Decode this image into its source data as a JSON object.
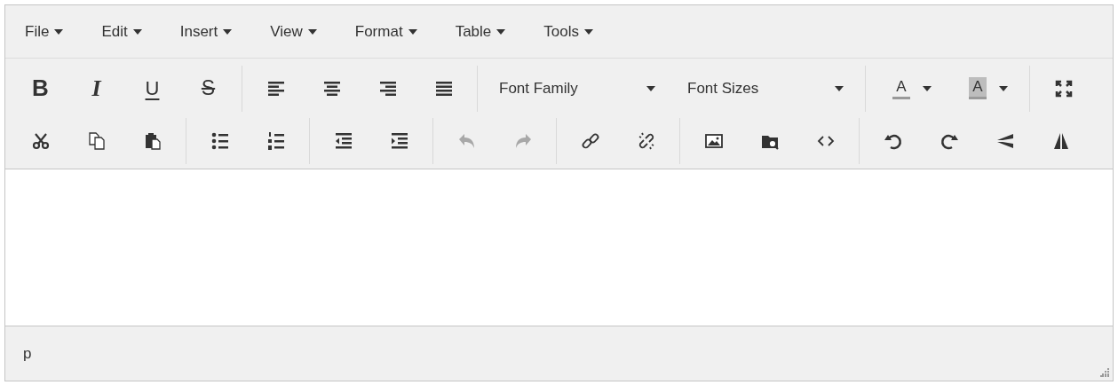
{
  "menubar": [
    {
      "label": "File"
    },
    {
      "label": "Edit"
    },
    {
      "label": "Insert"
    },
    {
      "label": "View"
    },
    {
      "label": "Format"
    },
    {
      "label": "Table"
    },
    {
      "label": "Tools"
    }
  ],
  "toolbar_rows": [
    [
      {
        "buttons": [
          {
            "kind": "bold",
            "label": "B",
            "disabled": false
          },
          {
            "kind": "italic",
            "label": "I",
            "disabled": false
          },
          {
            "kind": "underline",
            "label": "U",
            "disabled": false
          },
          {
            "kind": "strikethrough",
            "label": "S",
            "disabled": false
          }
        ]
      },
      {
        "buttons": [
          {
            "kind": "align-left",
            "disabled": false
          },
          {
            "kind": "align-center",
            "disabled": false
          },
          {
            "kind": "align-right",
            "disabled": false
          },
          {
            "kind": "align-justify",
            "disabled": false
          }
        ]
      },
      {
        "buttons": [
          {
            "kind": "listbox",
            "label": "Font Family",
            "disabled": false
          },
          {
            "kind": "listbox",
            "label": "Font Sizes",
            "disabled": false
          }
        ]
      },
      {
        "buttons": [
          {
            "kind": "forecolor",
            "label": "A",
            "disabled": false
          },
          {
            "kind": "backcolor",
            "label": "A",
            "disabled": false
          }
        ]
      },
      {
        "buttons": [
          {
            "kind": "fullscreen",
            "disabled": false
          }
        ]
      }
    ],
    [
      {
        "buttons": [
          {
            "kind": "cut",
            "disabled": false
          },
          {
            "kind": "copy",
            "disabled": false
          },
          {
            "kind": "paste",
            "disabled": false
          }
        ]
      },
      {
        "buttons": [
          {
            "kind": "bullet-list",
            "disabled": false
          },
          {
            "kind": "numbered-list",
            "disabled": false
          }
        ]
      },
      {
        "buttons": [
          {
            "kind": "outdent",
            "disabled": false
          },
          {
            "kind": "indent",
            "disabled": false
          }
        ]
      },
      {
        "buttons": [
          {
            "kind": "undo",
            "disabled": true
          },
          {
            "kind": "redo",
            "disabled": true
          }
        ]
      },
      {
        "buttons": [
          {
            "kind": "link",
            "disabled": false
          },
          {
            "kind": "unlink",
            "disabled": false
          }
        ]
      },
      {
        "buttons": [
          {
            "kind": "image",
            "disabled": false
          },
          {
            "kind": "browse",
            "disabled": false
          },
          {
            "kind": "code",
            "disabled": false
          }
        ]
      },
      {
        "buttons": [
          {
            "kind": "rotate-left",
            "disabled": false
          },
          {
            "kind": "rotate-right",
            "disabled": false
          },
          {
            "kind": "flip-vertical",
            "disabled": false
          },
          {
            "kind": "flip-horizontal",
            "disabled": false
          }
        ]
      }
    ]
  ],
  "status_bar": {
    "path": "p"
  }
}
